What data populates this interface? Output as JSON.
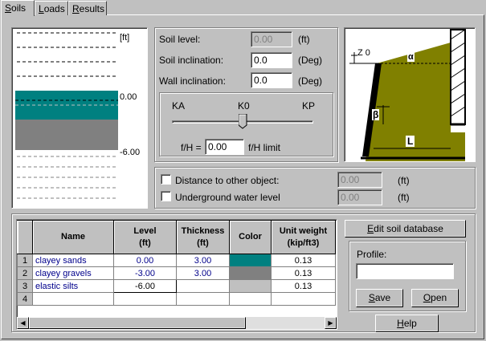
{
  "tabs": [
    {
      "label": "Soils",
      "underline": "S",
      "rest": "oils"
    },
    {
      "label": "Loads",
      "underline": "L",
      "rest": "oads"
    },
    {
      "label": "Results",
      "underline": "R",
      "rest": "esults"
    }
  ],
  "profile_view": {
    "unit": "[ft]",
    "level_top": "0.00",
    "level_bottom": "-6.00",
    "colors": {
      "layer1": "#008080",
      "layer2": "#808080",
      "water_lines": "#808080"
    }
  },
  "params": {
    "soil_level": {
      "label": "Soil level:",
      "value": "0.00",
      "unit": "(ft)"
    },
    "soil_inclination": {
      "label": "Soil inclination:",
      "value": "0.0",
      "unit": "(Deg)"
    },
    "wall_inclination": {
      "label": "Wall inclination:",
      "value": "0.0",
      "unit": "(Deg)"
    },
    "slider": {
      "ka": "KA",
      "k0": "K0",
      "kp": "KP",
      "position_fraction": 0.5
    },
    "fh": {
      "label": "f/H =",
      "value": "0.00",
      "suffix": "f/H limit"
    }
  },
  "diagram": {
    "z0": "Z 0",
    "alpha": "α",
    "beta": "β",
    "L": "L",
    "colors": {
      "soil": "#808000",
      "bg": "#ffffff"
    }
  },
  "options": {
    "distance": {
      "label": "Distance to other object:",
      "value": "0.00",
      "unit": "(ft)",
      "checked": false
    },
    "water": {
      "label": "Underground water level",
      "value": "0.00",
      "unit": "(ft)",
      "checked": false
    }
  },
  "grid": {
    "headers": {
      "name": "Name",
      "level": "Level",
      "level_unit": "(ft)",
      "thickness": "Thickness",
      "thickness_unit": "(ft)",
      "color": "Color",
      "unit_weight": "Unit weight",
      "unit_weight_unit": "(kip/ft3)"
    },
    "rows": [
      {
        "idx": "1",
        "name": "clayey sands",
        "level": "0.00",
        "thickness": "3.00",
        "color": "#008080",
        "unit_weight": "0.13"
      },
      {
        "idx": "2",
        "name": "clayey gravels",
        "level": "-3.00",
        "thickness": "3.00",
        "color": "#808080",
        "unit_weight": "0.13"
      },
      {
        "idx": "3",
        "name": "elastic silts",
        "level": "-6.00",
        "thickness": "",
        "color": "#c0c0c0",
        "unit_weight": "0.13"
      },
      {
        "idx": "4",
        "name": "",
        "level": "",
        "thickness": "",
        "color": "",
        "unit_weight": ""
      }
    ]
  },
  "buttons": {
    "edit_db": {
      "label": "Edit soil database",
      "underline": "E",
      "rest": "dit soil database"
    },
    "profile_label": "Profile:",
    "profile_value": "",
    "save": {
      "label": "Save",
      "underline": "S",
      "rest": "ave"
    },
    "open": {
      "label": "Open",
      "underline": "O",
      "rest": "pen"
    },
    "help": {
      "label": "Help",
      "underline": "H",
      "rest": "elp"
    }
  }
}
